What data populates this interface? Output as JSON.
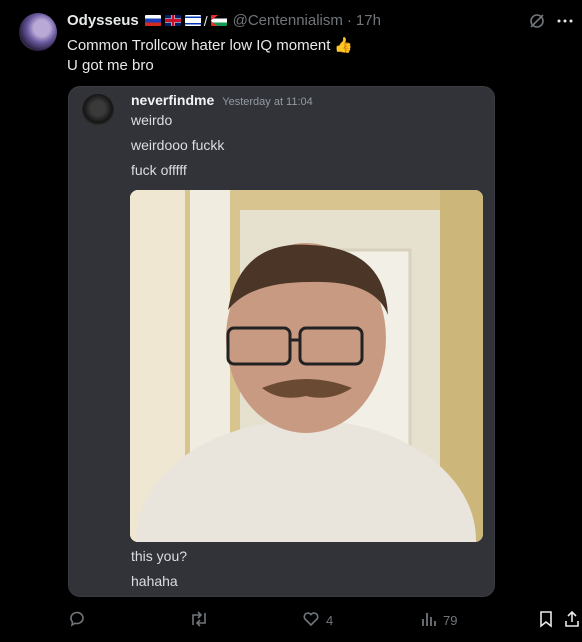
{
  "tweet": {
    "display_name": "Odysseus",
    "handle": "@Centennialism",
    "separator": "·",
    "time": "17h",
    "flag_slash": "/",
    "flags": [
      "russia-flag",
      "uk-flag",
      "israel-flag",
      "palestine-flag"
    ],
    "text_lines": [
      "Common Trollcow hater low IQ moment",
      "U got me bro"
    ],
    "emoji": "👍"
  },
  "discord_card": {
    "username": "neverfindme",
    "timestamp": "Yesterday at 11:04",
    "messages_before": [
      "weirdo",
      "weirdooo fuckk",
      "fuck offfff"
    ],
    "messages_after": [
      "this you?",
      "hahaha"
    ]
  },
  "actions": {
    "likes": "4",
    "views": "79"
  },
  "colors": {
    "background": "#000000",
    "card_background": "#313338",
    "muted_text": "#71767b"
  },
  "icons": [
    "grok-icon",
    "more-icon",
    "reply-icon",
    "retweet-icon",
    "like-icon",
    "views-icon",
    "bookmark-icon",
    "share-icon"
  ]
}
